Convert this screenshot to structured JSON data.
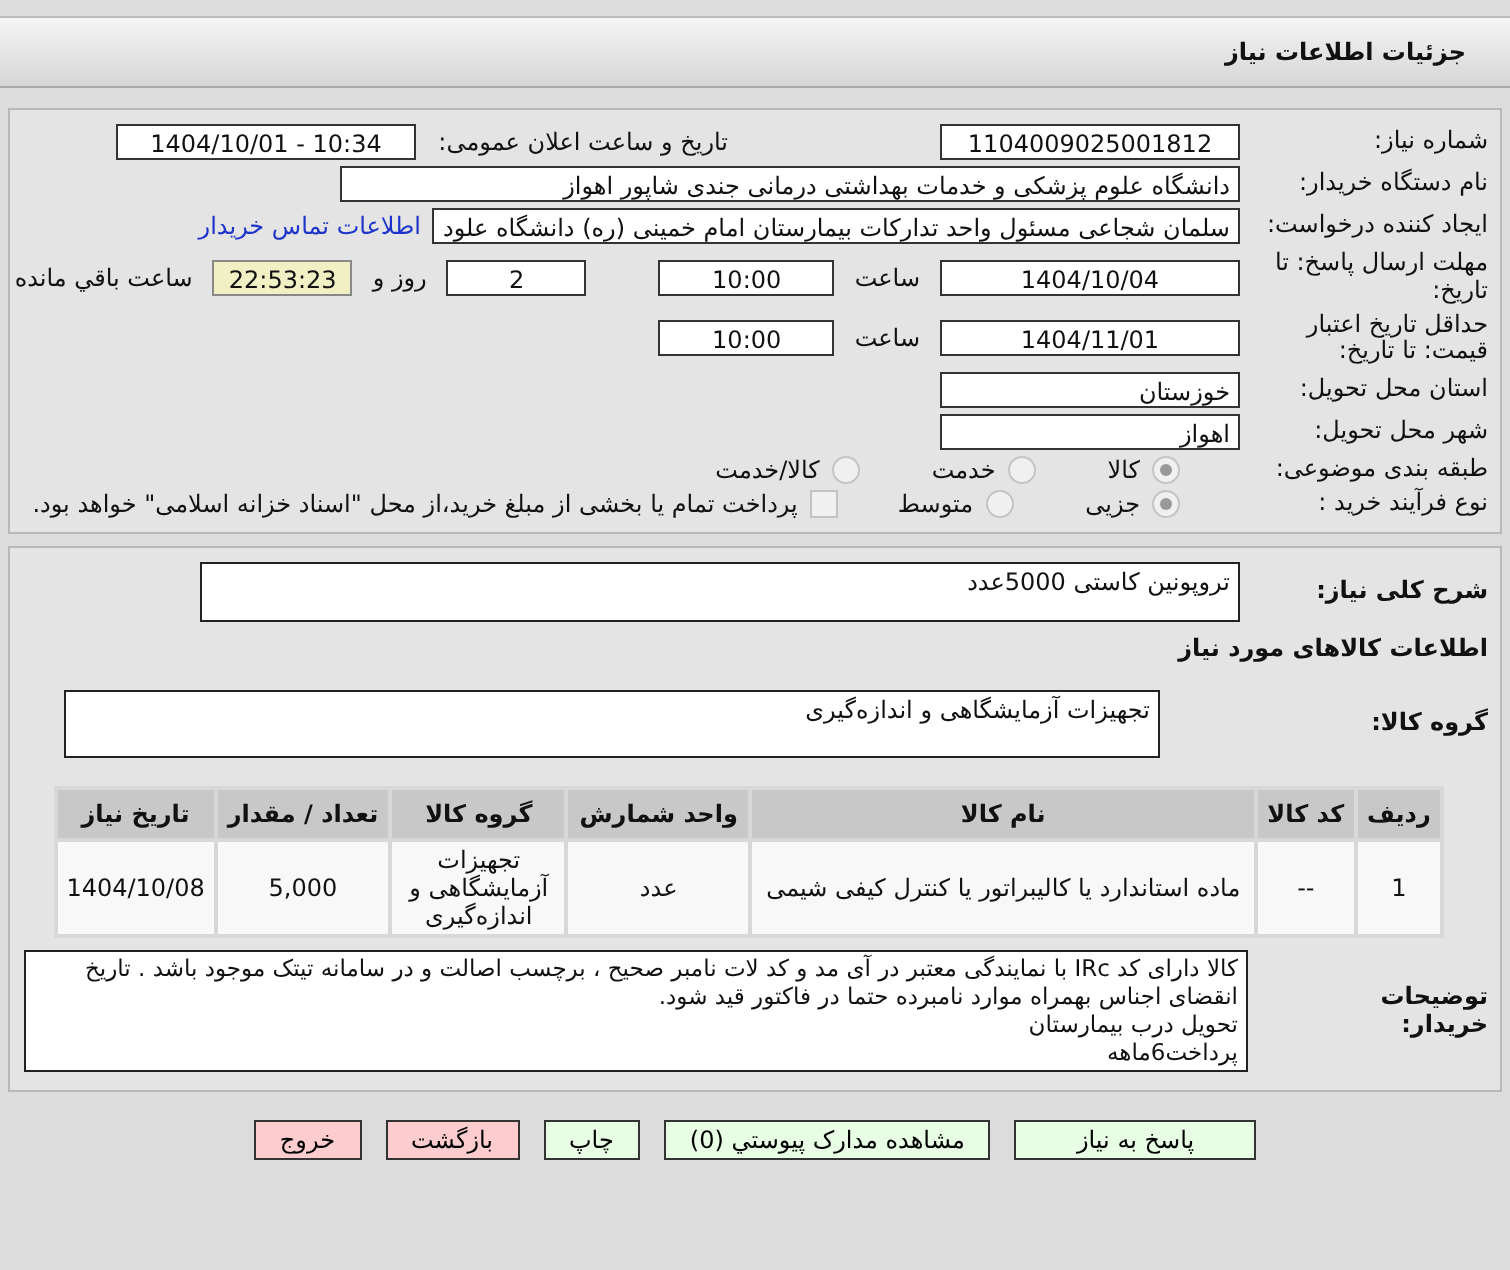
{
  "title": "جزئیات اطلاعات نیاز",
  "need_number": {
    "label": "شماره نیاز:",
    "value": "1104009025001812"
  },
  "announce": {
    "label": "تاریخ و ساعت اعلان عمومی:",
    "value": "1404/10/01 - 10:34"
  },
  "buyer": {
    "label": "نام دستگاه خريدار:",
    "value": "دانشگاه علوم پزشکی و خدمات بهداشتی درمانی جندی شاپور اهواز"
  },
  "creator": {
    "label": "ایجاد کننده درخواست:",
    "value": "سلمان شجاعی مسئول واحد تدارکات بیمارستان امام خمینی (ره) دانشگاه علود",
    "link": "اطلاعات تماس خریدار"
  },
  "deadline": {
    "label": "مهلت ارسال پاسخ: تا تاریخ:",
    "date": "1404/10/04",
    "time_label": "ساعت",
    "time": "10:00",
    "days": "2",
    "days_label": "روز و",
    "remaining": "22:53:23",
    "remaining_label": "ساعت باقي مانده"
  },
  "validity": {
    "label": "حداقل تاریخ اعتبار قیمت: تا تاریخ:",
    "date": "1404/11/01",
    "time_label": "ساعت",
    "time": "10:00"
  },
  "province": {
    "label": "استان محل تحویل:",
    "value": "خوزستان"
  },
  "city": {
    "label": "شهر محل تحویل:",
    "value": "اهواز"
  },
  "category": {
    "label": "طبقه بندی موضوعی:",
    "options": [
      {
        "label": "کالا",
        "selected": true
      },
      {
        "label": "خدمت",
        "selected": false
      },
      {
        "label": "کالا/خدمت",
        "selected": false
      }
    ]
  },
  "process": {
    "label": "نوع فرآیند خرید :",
    "options": [
      {
        "label": "جزیی",
        "selected": true
      },
      {
        "label": "متوسط",
        "selected": false
      }
    ],
    "treasury": {
      "label": "پرداخت تمام یا بخشی از مبلغ خرید،از محل \"اسناد خزانه اسلامی\" خواهد بود.",
      "checked": false
    }
  },
  "summary": {
    "label": "شرح کلی نیاز:",
    "value": "تروپونین کاستی   5000عدد"
  },
  "goods_heading": "اطلاعات کالاهای مورد نیاز",
  "goods_group": {
    "label": "گروه کالا:",
    "value": "تجهیزات آزمایشگاهی و اندازه‌گیری"
  },
  "table": {
    "columns": [
      "ردیف",
      "کد کالا",
      "نام کالا",
      "واحد شمارش",
      "گروه کالا",
      "تعداد / مقدار",
      "تاریخ نیاز"
    ],
    "rows": [
      [
        "1",
        "--",
        "ماده استاندارد یا کالیبراتور یا کنترل کیفی شیمی",
        "عدد",
        "تجهیزات آزمایشگاهی و اندازه‌گیری",
        "5,000",
        "1404/10/08"
      ]
    ]
  },
  "notes": {
    "label": "توضیحات خریدار:",
    "lines": [
      "کالا دارای کد IRc با نمایندگی معتبر در آی مد و کد لات نامبر صحیح ، برچسب اصالت و در سامانه تیتک موجود باشد . تاریخ انقضای اجناس بهمراه موارد نامبرده حتما در فاکتور قید شود.",
      "تحویل درب بیمارستان",
      "پرداخت6ماهه"
    ]
  },
  "buttons": [
    {
      "label": "پاسخ به نیاز",
      "kind": "action"
    },
    {
      "label": "مشاهده مدارک پیوستي (0)",
      "kind": "action"
    },
    {
      "label": "چاپ",
      "kind": "action"
    },
    {
      "label": "بازگشت",
      "kind": "exit"
    },
    {
      "label": "خروج",
      "kind": "exit"
    }
  ]
}
